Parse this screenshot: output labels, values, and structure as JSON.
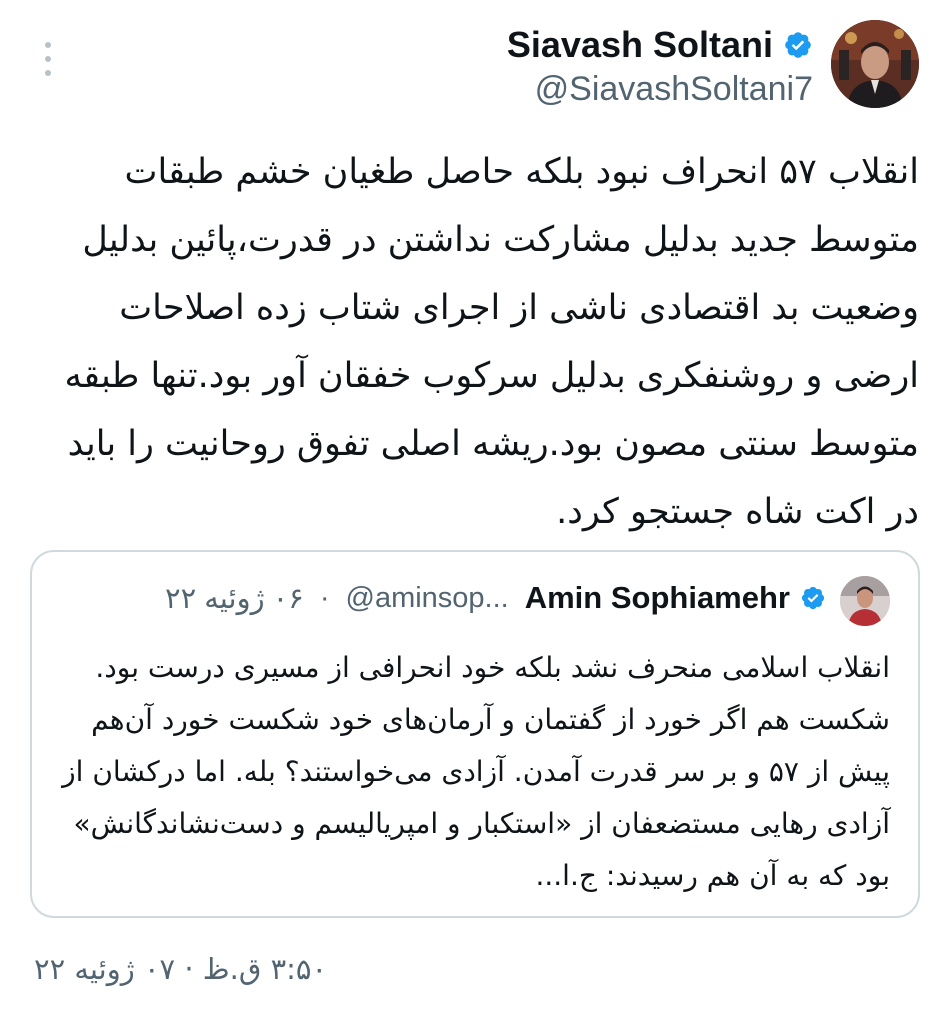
{
  "tweet": {
    "author": {
      "name": "Siavash Soltani",
      "handle": "@SiavashSoltani7",
      "verified": true,
      "avatar_icon": "profile-photo"
    },
    "more_icon": "vertical-ellipsis-icon",
    "text": "انقلاب ۵۷ انحراف نبود بلکه حاصل طغیان خشم طبقات متوسط جدید بدلیل مشارکت نداشتن در قدرت،پائین بدلیل وضعیت بد اقتصادی ناشی از اجرای شتاب زده اصلاحات ارضی و روشنفکری بدلیل سرکوب خفقان آور بود.تنها طبقه متوسط سنتی مصون بود.ریشه اصلی تفوق روحانیت را باید در اکت شاه جستجو کرد.",
    "timestamp": "۳:۵۰ ق.ظ · ۰۷ ژوئیه ۲۲"
  },
  "quoted_tweet": {
    "author": {
      "name": "Amin Sophiamehr",
      "handle": "@aminsop...",
      "verified": true
    },
    "date": "۰۶ ژوئیه ۲۲",
    "separator": "·",
    "text": "انقلاب اسلامی منحرف نشد بلکه خود انحرافی از مسیری درست بود. شکست هم اگر خورد از گفتمان و آرمان‌های خود شکست خورد آن‌هم پیش از ۵۷ و بر سر قدرت آمدن. آزادی می‌خواستند؟ بله. اما درکشان از آزادی رهایی مستضعفان از «استکبار و امپریالیسم و دست‌نشاندگانش» بود که به آن هم رسیدند: ج.ا..."
  },
  "colors": {
    "text_primary": "#0f1419",
    "text_secondary": "#536471",
    "verified_blue": "#1d9bf0",
    "border": "#cfd9de"
  }
}
